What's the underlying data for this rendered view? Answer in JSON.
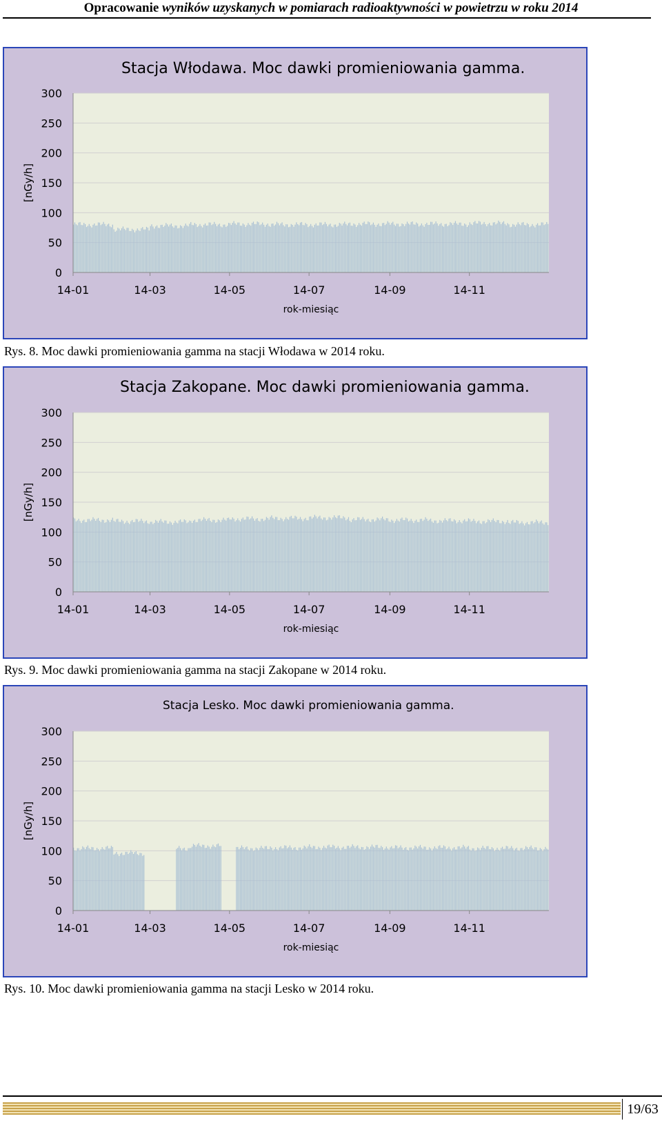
{
  "header": {
    "title_normal": "Opracowanie ",
    "title_italic": "wyników uzyskanych w pomiarach radioaktywności w powietrzu w roku 2014"
  },
  "colors": {
    "chart_background": "#ccc1da",
    "plot_background": "#ebeedf",
    "bars": "#a8bfd4",
    "border": "#2a45b8",
    "gridline": "#d0d0d0"
  },
  "chart_data": [
    {
      "type": "bar",
      "title": "Stacja Włodawa. Moc dawki promieniowania gamma.",
      "xlabel": "rok-miesiąc",
      "ylabel": "[nGy/h]",
      "ylim": [
        0,
        300
      ],
      "yticks": [
        0,
        50,
        100,
        150,
        200,
        250,
        300
      ],
      "xticks": [
        "14-01",
        "14-03",
        "14-05",
        "14-07",
        "14-09",
        "14-11"
      ],
      "grid": true,
      "x": [
        "2014-01",
        "2014-02",
        "2014-03",
        "2014-04",
        "2014-05",
        "2014-06",
        "2014-07",
        "2014-08",
        "2014-09",
        "2014-10",
        "2014-11",
        "2014-12"
      ],
      "values": [
        80,
        72,
        78,
        80,
        81,
        80,
        80,
        81,
        81,
        81,
        82,
        80
      ],
      "gaps": []
    },
    {
      "type": "bar",
      "title": "Stacja Zakopane. Moc dawki promieniowania gamma.",
      "xlabel": "rok-miesiąc",
      "ylabel": "[nGy/h]",
      "ylim": [
        0,
        300
      ],
      "yticks": [
        0,
        50,
        100,
        150,
        200,
        250,
        300
      ],
      "xticks": [
        "14-01",
        "14-03",
        "14-05",
        "14-07",
        "14-09",
        "14-11"
      ],
      "grid": true,
      "x": [
        "2014-01",
        "2014-02",
        "2014-03",
        "2014-04",
        "2014-05",
        "2014-06",
        "2014-07",
        "2014-08",
        "2014-09",
        "2014-10",
        "2014-11",
        "2014-12"
      ],
      "values": [
        120,
        118,
        117,
        120,
        122,
        123,
        124,
        121,
        120,
        119,
        118,
        116
      ],
      "gaps": []
    },
    {
      "type": "bar",
      "title": "Stacja Lesko. Moc dawki promieniowania gamma.",
      "xlabel": "rok-miesiąc",
      "ylabel": "[nGy/h]",
      "ylim": [
        0,
        300
      ],
      "yticks": [
        0,
        50,
        100,
        150,
        200,
        250,
        300
      ],
      "xticks": [
        "14-01",
        "14-03",
        "14-05",
        "14-07",
        "14-09",
        "14-11"
      ],
      "grid": true,
      "x": [
        "2014-01",
        "2014-02",
        "2014-03",
        "2014-04",
        "2014-05",
        "2014-06",
        "2014-07",
        "2014-08",
        "2014-09",
        "2014-10",
        "2014-11",
        "2014-12"
      ],
      "values": [
        104,
        96,
        104,
        108,
        104,
        105,
        106,
        106,
        105,
        105,
        104,
        104
      ],
      "gaps": [
        [
          "2014-02-25",
          "2014-03-20"
        ],
        [
          "2014-04-25",
          "2014-05-05"
        ]
      ]
    }
  ],
  "captions": [
    "Rys. 8. Moc dawki promieniowania gamma na stacji Włodawa w 2014 roku.",
    "Rys. 9. Moc dawki promieniowania gamma na stacji Zakopane w 2014 roku.",
    "Rys. 10. Moc dawki promieniowania gamma na stacji Lesko w 2014 roku."
  ],
  "footer": {
    "page_number": "19/63"
  }
}
